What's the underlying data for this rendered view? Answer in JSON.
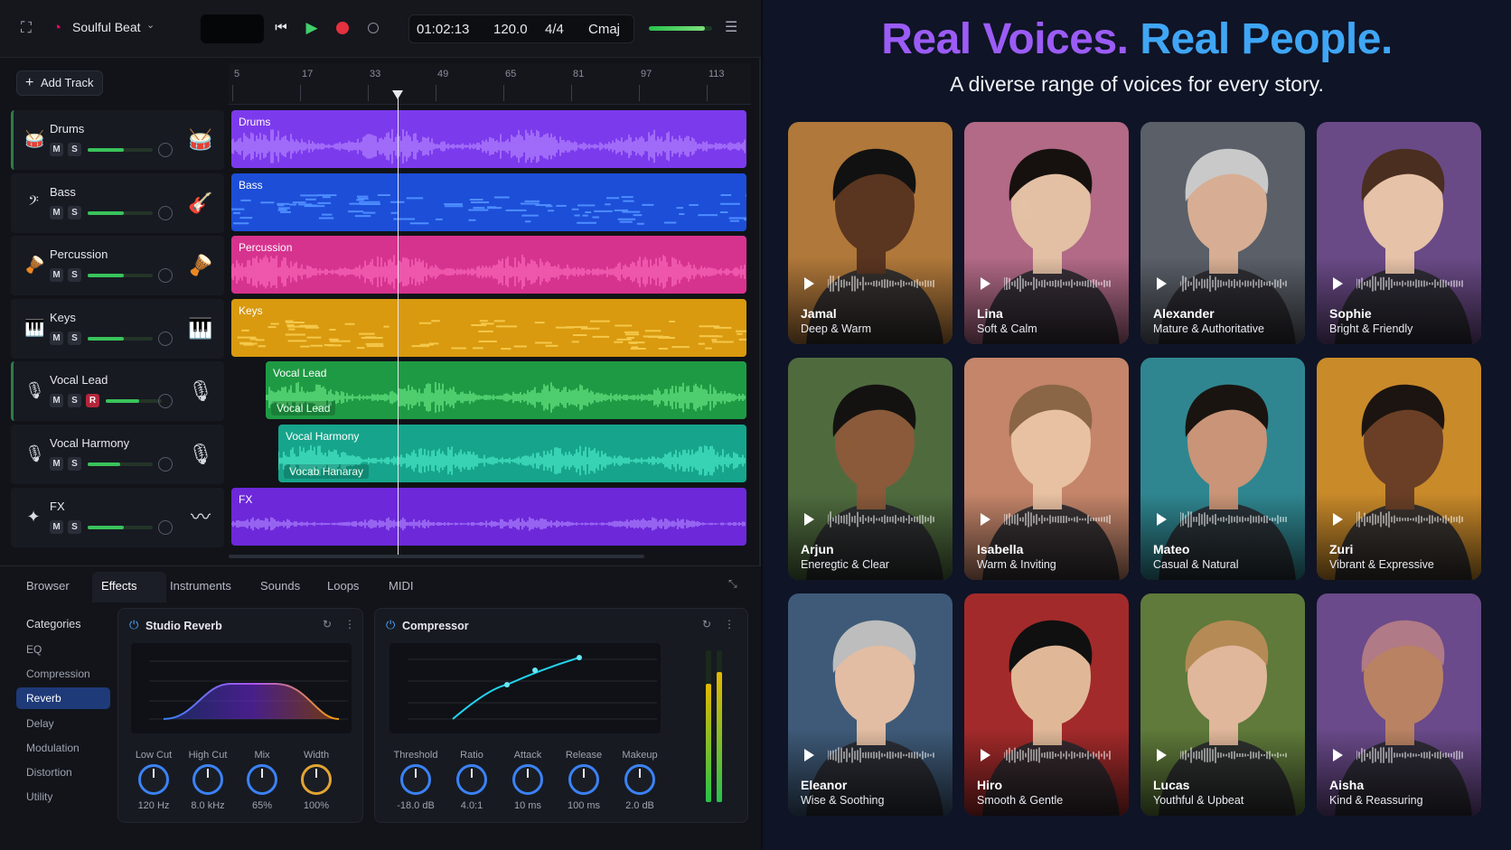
{
  "daw": {
    "project_name": "Soulful Beat",
    "transport": {
      "time": "01:02:13",
      "tempo": "120.0",
      "signature": "4/4",
      "key": "Cmaj"
    },
    "add_track_label": "Add Track",
    "ruler": [
      "5",
      "17",
      "33",
      "49",
      "65",
      "81",
      "97",
      "113"
    ],
    "master_level": 0.88,
    "tracks": [
      {
        "name": "Drums",
        "icon": "drum-icon",
        "instrument_icon": "drum-kit-icon",
        "color": "#7c3aed",
        "clip_label": "Drums",
        "rec": false,
        "volume": 0.55
      },
      {
        "name": "Bass",
        "icon": "bass-icon",
        "instrument_icon": "guitar-icon",
        "color": "#1d4ed8",
        "clip_label": "Bass",
        "rec": false,
        "volume": 0.55
      },
      {
        "name": "Percussion",
        "icon": "percussion-icon",
        "instrument_icon": "djembe-icon",
        "color": "#d6338f",
        "clip_label": "Percussion",
        "rec": false,
        "volume": 0.55
      },
      {
        "name": "Keys",
        "icon": "piano-icon",
        "instrument_icon": "keyboard-icon",
        "color": "#d99a0f",
        "clip_label": "Keys",
        "rec": false,
        "volume": 0.55
      },
      {
        "name": "Vocal Lead",
        "icon": "microphone-icon",
        "instrument_icon": "microphone-icon",
        "color": "#1f9a44",
        "clip_label": "Vocal Lead",
        "clip_sublabel": "Vocal Lead",
        "rec": true,
        "volume": 0.6
      },
      {
        "name": "Vocal Harmony",
        "icon": "microphone-icon",
        "instrument_icon": "microphone-icon",
        "color": "#16a58c",
        "clip_label": "Vocal Harmony",
        "clip_sublabel": "Vocab Hanaray",
        "rec": false,
        "volume": 0.5
      },
      {
        "name": "FX",
        "icon": "fx-icon",
        "instrument_icon": "waveform-icon",
        "color": "#6d28d9",
        "clip_label": "FX",
        "rec": false,
        "volume": 0.55
      }
    ],
    "mute_label": "M",
    "solo_label": "S",
    "rec_label": "R"
  },
  "browser": {
    "tabs": [
      "Browser",
      "Effects",
      "Instruments",
      "Sounds",
      "Loops",
      "MIDI"
    ],
    "active_tab": "Effects",
    "categories_title": "Categories",
    "categories": [
      "EQ",
      "Compression",
      "Reverb",
      "Delay",
      "Modulation",
      "Distortion",
      "Utility"
    ],
    "active_category": "Reverb",
    "reverb": {
      "title": "Studio Reverb",
      "knobs": [
        {
          "label": "Low Cut",
          "value": "120 Hz"
        },
        {
          "label": "High Cut",
          "value": "8.0 kHz"
        },
        {
          "label": "Mix",
          "value": "65%"
        },
        {
          "label": "Width",
          "value": "100%"
        }
      ]
    },
    "compressor": {
      "title": "Compressor",
      "knobs": [
        {
          "label": "Threshold",
          "value": "-18.0 dB"
        },
        {
          "label": "Ratio",
          "value": "4.0:1"
        },
        {
          "label": "Attack",
          "value": "10 ms"
        },
        {
          "label": "Release",
          "value": "100 ms"
        },
        {
          "label": "Makeup",
          "value": "2.0 dB"
        }
      ]
    }
  },
  "voices": {
    "title_part1": "Real Voices.",
    "title_part2": "Real People.",
    "subtitle": "A diverse range of voices for every story.",
    "cards": [
      {
        "name": "Jamal",
        "desc": "Deep & Warm",
        "bg": "#b0783a",
        "skin": "#5a3520",
        "hair": "#111111"
      },
      {
        "name": "Lina",
        "desc": "Soft & Calm",
        "bg": "#b26a86",
        "skin": "#e3c0a4",
        "hair": "#16110f"
      },
      {
        "name": "Alexander",
        "desc": "Mature & Authoritative",
        "bg": "#5a5f68",
        "skin": "#d7ae93",
        "hair": "#c9c9c9"
      },
      {
        "name": "Sophie",
        "desc": "Bright & Friendly",
        "bg": "#6a4a86",
        "skin": "#e6c2a8",
        "hair": "#4a2e20"
      },
      {
        "name": "Arjun",
        "desc": "Eneregtic & Clear",
        "bg": "#4f6b3e",
        "skin": "#8a5a3a",
        "hair": "#141210"
      },
      {
        "name": "Isabella",
        "desc": "Warm & Inviting",
        "bg": "#c4856a",
        "skin": "#e8c1a2",
        "hair": "#8a6646"
      },
      {
        "name": "Mateo",
        "desc": "Casual & Natural",
        "bg": "#2f8690",
        "skin": "#c99477",
        "hair": "#1a1410"
      },
      {
        "name": "Zuri",
        "desc": "Vibrant & Expressive",
        "bg": "#c98a2a",
        "skin": "#6a3f26",
        "hair": "#1c1410"
      },
      {
        "name": "Eleanor",
        "desc": "Wise & Soothing",
        "bg": "#3e5a78",
        "skin": "#e2bda3",
        "hair": "#bdbdbd"
      },
      {
        "name": "Hiro",
        "desc": "Smooth & Gentle",
        "bg": "#a32a2a",
        "skin": "#e0b898",
        "hair": "#101010"
      },
      {
        "name": "Lucas",
        "desc": "Youthful & Upbeat",
        "bg": "#5f7a3a",
        "skin": "#e0b79a",
        "hair": "#b58a55"
      },
      {
        "name": "Aisha",
        "desc": "Kind & Reassuring",
        "bg": "#6a4a8a",
        "skin": "#b98263",
        "hair": "#b07a86"
      }
    ]
  }
}
